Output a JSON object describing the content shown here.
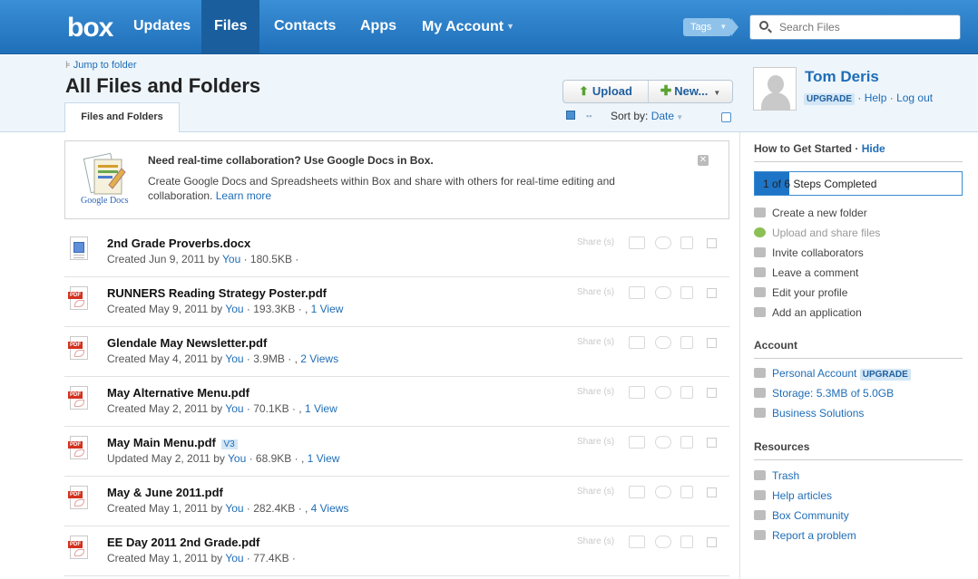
{
  "nav": {
    "logo": "box",
    "items": [
      {
        "label": "Updates"
      },
      {
        "label": "Files"
      },
      {
        "label": "Contacts"
      },
      {
        "label": "Apps"
      },
      {
        "label": "My Account"
      }
    ],
    "tags_label": "Tags",
    "search_placeholder": "Search Files"
  },
  "header": {
    "jump_link": "Jump to folder",
    "title": "All Files and Folders",
    "tab": "Files and Folders",
    "upload_label": "Upload",
    "new_label": "New...",
    "sort_label": "Sort by:",
    "sort_value": "Date"
  },
  "profile": {
    "name": "Tom Deris",
    "upgrade": "UPGRADE",
    "help": "Help",
    "logout": "Log out"
  },
  "promo": {
    "title": "Need real-time collaboration? Use Google Docs in Box.",
    "body": "Create Google Docs and Spreadsheets within Box and share with others for real-time editing and collaboration.",
    "link": "Learn more",
    "logo_text": "Google Docs"
  },
  "files": [
    {
      "name": "2nd Grade Proverbs.docx",
      "type": "doc",
      "meta": "Created Jun 9, 2011 by",
      "by": "You",
      "size": "· 180.5KB ·",
      "views": ""
    },
    {
      "name": "RUNNERS Reading Strategy Poster.pdf",
      "type": "pdf",
      "meta": "Created May 9, 2011 by",
      "by": "You",
      "size": "· 193.3KB · ,",
      "views": "1 View"
    },
    {
      "name": "Glendale May Newsletter.pdf",
      "type": "pdf",
      "meta": "Created May 4, 2011 by",
      "by": "You",
      "size": "· 3.9MB · ,",
      "views": "2 Views"
    },
    {
      "name": "May Alternative Menu.pdf",
      "type": "pdf",
      "meta": "Created May 2, 2011 by",
      "by": "You",
      "size": "· 70.1KB · ,",
      "views": "1 View"
    },
    {
      "name": "May Main Menu.pdf",
      "type": "pdf",
      "version": "V3",
      "meta": "Updated May 2, 2011 by",
      "by": "You",
      "size": "· 68.9KB · ,",
      "views": "1 View"
    },
    {
      "name": "May & June 2011.pdf",
      "type": "pdf",
      "meta": "Created May 1, 2011 by",
      "by": "You",
      "size": "· 282.4KB · ,",
      "views": "4 Views"
    },
    {
      "name": "EE Day 2011 2nd Grade.pdf",
      "type": "pdf",
      "meta": "Created May 1, 2011 by",
      "by": "You",
      "size": "· 77.4KB ·",
      "views": ""
    }
  ],
  "share_label": "Share (s)",
  "sidebar": {
    "started_title": "How to Get Started",
    "hide": "Hide",
    "progress_text": "1 of 6 Steps Completed",
    "progress_fraction": 0.1667,
    "steps": [
      {
        "label": "Create a new folder",
        "icon": "folder-icon",
        "done": false
      },
      {
        "label": "Upload and share files",
        "icon": "check-icon",
        "done": true
      },
      {
        "label": "Invite collaborators",
        "icon": "envelope-icon",
        "done": false
      },
      {
        "label": "Leave a comment",
        "icon": "comment-icon",
        "done": false
      },
      {
        "label": "Edit your profile",
        "icon": "person-icon",
        "done": false
      },
      {
        "label": "Add an application",
        "icon": "plus-icon",
        "done": false
      }
    ],
    "account_title": "Account",
    "account_items": [
      {
        "label": "Personal Account",
        "badge": "UPGRADE",
        "icon": "user-card-icon"
      },
      {
        "label": "Storage: 5.3MB of 5.0GB",
        "icon": "pie-icon"
      },
      {
        "label": "Business Solutions",
        "icon": "briefcase-icon"
      }
    ],
    "resources_title": "Resources",
    "resource_items": [
      {
        "label": "Trash",
        "icon": "trash-icon"
      },
      {
        "label": "Help articles",
        "icon": "help-icon"
      },
      {
        "label": "Box Community",
        "icon": "community-icon"
      },
      {
        "label": "Report a problem",
        "icon": "alert-icon"
      }
    ]
  }
}
